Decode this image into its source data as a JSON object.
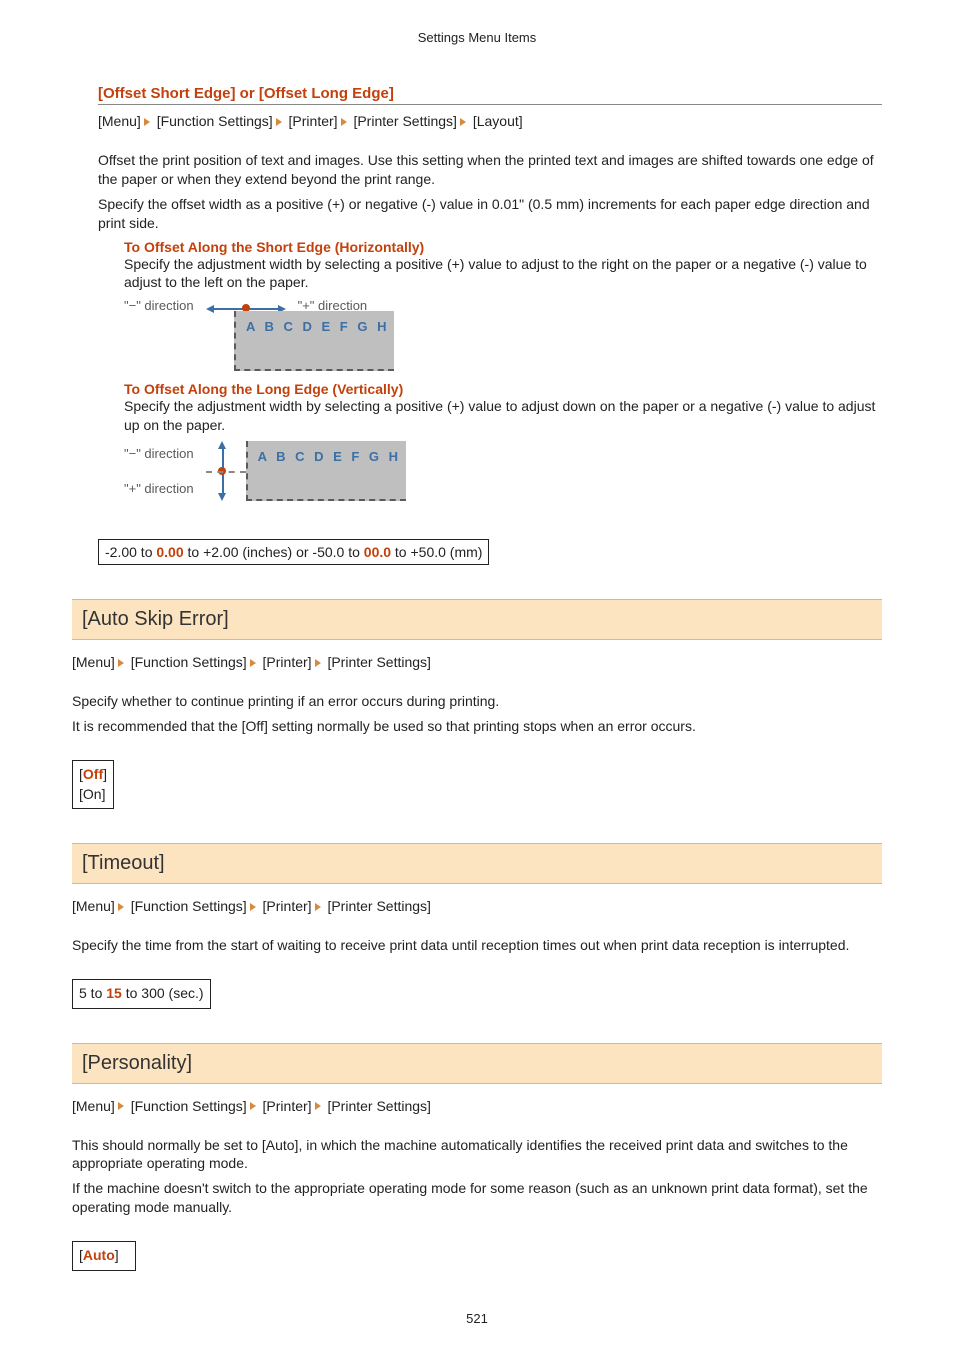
{
  "header": "Settings Menu Items",
  "page_number": "521",
  "offset_edge": {
    "title": "[Offset Short Edge] or [Offset Long Edge]",
    "crumbs": [
      "[Menu]",
      "[Function Settings]",
      "[Printer]",
      "[Printer Settings]",
      "[Layout]"
    ],
    "desc1": "Offset the print position of text and images. Use this setting when the printed text and images are shifted towards one edge of the paper or when they extend beyond the print range.",
    "desc2": "Specify the offset width as a positive (+) or negative (-) value in 0.01\" (0.5 mm) increments for each paper edge direction and print side.",
    "short": {
      "title": "To Offset Along the Short Edge (Horizontally)",
      "desc": "Specify the adjustment width by selecting a positive (+) value to adjust to the right on the paper or a negative (-) value to adjust to the left on the paper.",
      "neg": "\"−\" direction",
      "pos": "\"+\" direction",
      "sample": "A B C D E F G H"
    },
    "long": {
      "title": "To Offset Along the Long Edge (Vertically)",
      "desc": "Specify the adjustment width by selecting a positive (+) value to adjust down on the paper or a negative (-) value to adjust up on the paper.",
      "neg": "\"−\" direction",
      "pos": "\"+\" direction",
      "sample": "A B C D E F G H"
    },
    "range": {
      "p1": "-2.00 to ",
      "d1": "0.00",
      "p2": " to +2.00 (inches) or -50.0 to ",
      "d2": "00.0",
      "p3": " to +50.0 (mm)"
    }
  },
  "auto_skip": {
    "title": "[Auto Skip Error]",
    "crumbs": [
      "[Menu]",
      "[Function Settings]",
      "[Printer]",
      "[Printer Settings]"
    ],
    "desc1": "Specify whether to continue printing if an error occurs during printing.",
    "desc2": "It is recommended that the [Off] setting normally be used so that printing stops when an error occurs.",
    "opt_lb": "[",
    "opt_default": "Off",
    "opt_rb": "]",
    "opt_on": "[On]"
  },
  "timeout": {
    "title": "[Timeout]",
    "crumbs": [
      "[Menu]",
      "[Function Settings]",
      "[Printer]",
      "[Printer Settings]"
    ],
    "desc": "Specify the time from the start of waiting to receive print data until reception times out when print data reception is interrupted.",
    "r1": "5 to ",
    "rd": "15",
    "r2": " to 300 (sec.)"
  },
  "personality": {
    "title": "[Personality]",
    "crumbs": [
      "[Menu]",
      "[Function Settings]",
      "[Printer]",
      "[Printer Settings]"
    ],
    "desc1": "This should normally be set to [Auto], in which the machine automatically identifies the received print data and switches to the appropriate operating mode.",
    "desc2": "If the machine doesn't switch to the appropriate operating mode for some reason (such as an unknown print data format), set the operating mode manually.",
    "opt_lb": "[",
    "opt_default": "Auto",
    "opt_rb": "]"
  }
}
